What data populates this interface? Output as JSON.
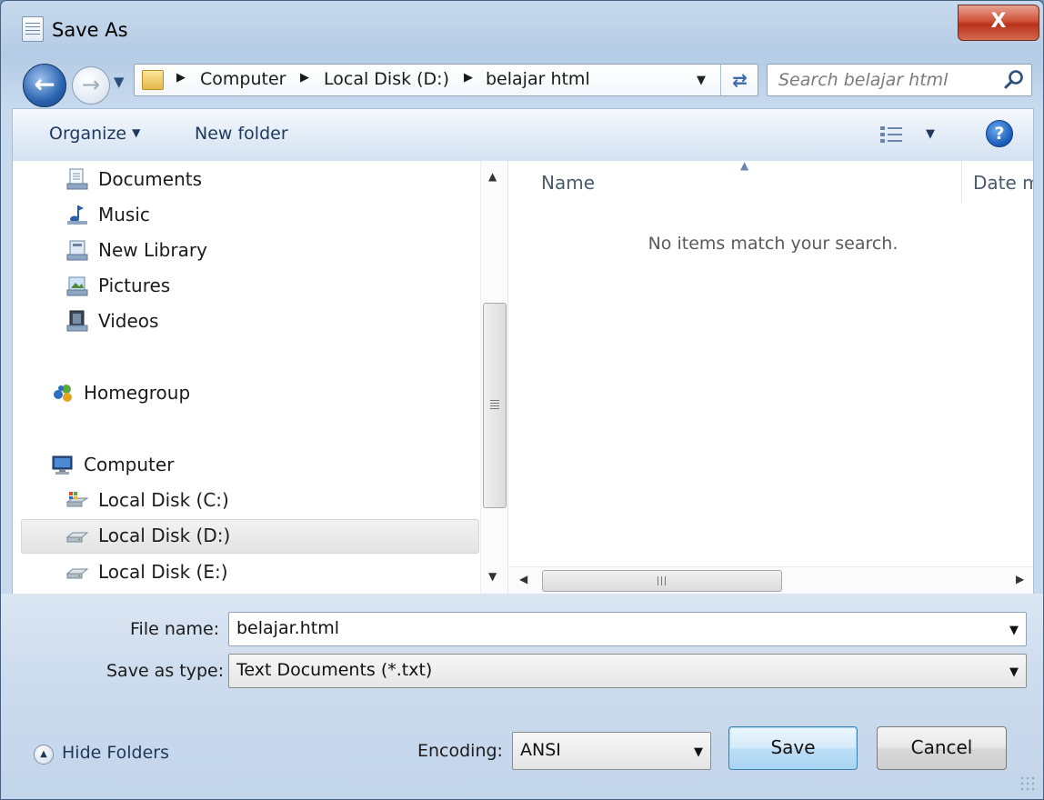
{
  "window": {
    "title": "Save As",
    "close_glyph": "X"
  },
  "nav": {
    "back_icon": "back-arrow-icon",
    "forward_icon": "forward-arrow-icon"
  },
  "address": {
    "breadcrumbs": [
      "Computer",
      "Local Disk (D:)",
      "belajar html"
    ]
  },
  "search": {
    "placeholder": "Search belajar html"
  },
  "toolbar": {
    "organize_label": "Organize",
    "new_folder_label": "New folder",
    "help_glyph": "?"
  },
  "sidebar": {
    "items": [
      {
        "label": "Documents",
        "icon": "documents-library-icon"
      },
      {
        "label": "Music",
        "icon": "music-library-icon"
      },
      {
        "label": "New Library",
        "icon": "library-icon"
      },
      {
        "label": "Pictures",
        "icon": "pictures-library-icon"
      },
      {
        "label": "Videos",
        "icon": "videos-library-icon"
      },
      {
        "label": "Homegroup",
        "icon": "homegroup-icon"
      },
      {
        "label": "Computer",
        "icon": "computer-icon"
      },
      {
        "label": "Local Disk (C:)",
        "icon": "system-drive-icon"
      },
      {
        "label": "Local Disk (D:)",
        "icon": "drive-icon",
        "selected": true
      },
      {
        "label": "Local Disk (E:)",
        "icon": "drive-icon"
      }
    ]
  },
  "filelist": {
    "columns": [
      "Name",
      "Date m"
    ],
    "empty_message": "No items match your search."
  },
  "form": {
    "file_name_label": "File name:",
    "file_name_value": "belajar.html",
    "save_type_label": "Save as type:",
    "save_type_value": "Text Documents (*.txt)",
    "encoding_label": "Encoding:",
    "encoding_value": "ANSI"
  },
  "buttons": {
    "save": "Save",
    "cancel": "Cancel",
    "hide_folders": "Hide Folders"
  },
  "colors": {
    "accent": "#1e395b",
    "close_red": "#c8412a",
    "selection": "#e6e6e6"
  }
}
